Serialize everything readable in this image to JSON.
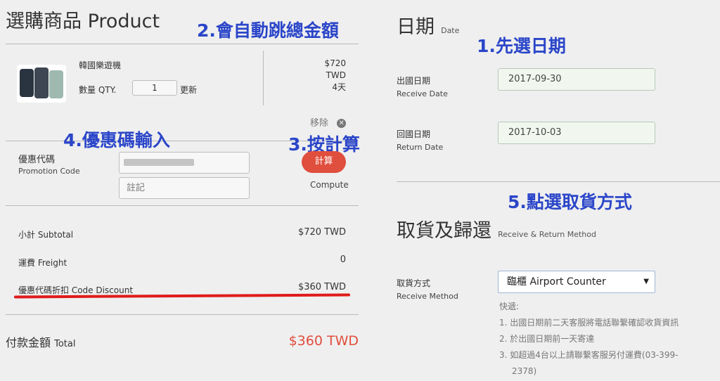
{
  "product_section": {
    "title": "選購商品 Product",
    "item_name": "韓國樂遊機",
    "qty_label": "數量 QTY.",
    "qty_value": "1",
    "update_label": "更新",
    "price_line1": "$720",
    "price_line2": "TWD",
    "price_line3": "4天",
    "remove_label": "移除"
  },
  "promo": {
    "label_zh": "優惠代碼",
    "label_en": "Promotion Code",
    "note_placeholder": "註記",
    "compute_button": "計算",
    "compute_en": "Compute"
  },
  "summary": {
    "subtotal_label": "小計 Subtotal",
    "subtotal_value": "$720 TWD",
    "freight_label": "運費 Freight",
    "freight_value": "0",
    "discount_label": "優惠代碼折扣 Code Discount",
    "discount_value": "$360 TWD",
    "total_label": "付款金額",
    "total_label_en": "Total",
    "total_value": "$360 TWD"
  },
  "date_section": {
    "title": "日期",
    "title_en": "Date",
    "depart_label_zh": "出國日期",
    "depart_label_en": "Receive Date",
    "depart_value": "2017-09-30",
    "return_label_zh": "回國日期",
    "return_label_en": "Return Date",
    "return_value": "2017-10-03"
  },
  "method_section": {
    "title": "取貨及歸還",
    "title_en": "Receive & Return Method",
    "method_label_zh": "取貨方式",
    "method_label_en": "Receive Method",
    "method_value": "臨櫃 Airport Counter",
    "notes_title": "快遞:",
    "note1": "1. 出國日期前二天客服將電話聯繫確認收貨資訊",
    "note2": "2. 於出國日期前一天寄達",
    "note3a": "3. 如超過4台以上請聯繫客服另付運費(03-399-",
    "note3b": "2378)"
  },
  "annotations": {
    "a1": "1.先選日期",
    "a2": "2.會自動跳總金額",
    "a3": "3.按計算",
    "a4": "4.優惠碼輸入",
    "a5": "5.點選取貨方式"
  },
  "colors": {
    "annotation": "#2b46c9",
    "compute_button": "#e04e3d",
    "total_value": "#e04e3d",
    "underline": "#e01b1b"
  }
}
